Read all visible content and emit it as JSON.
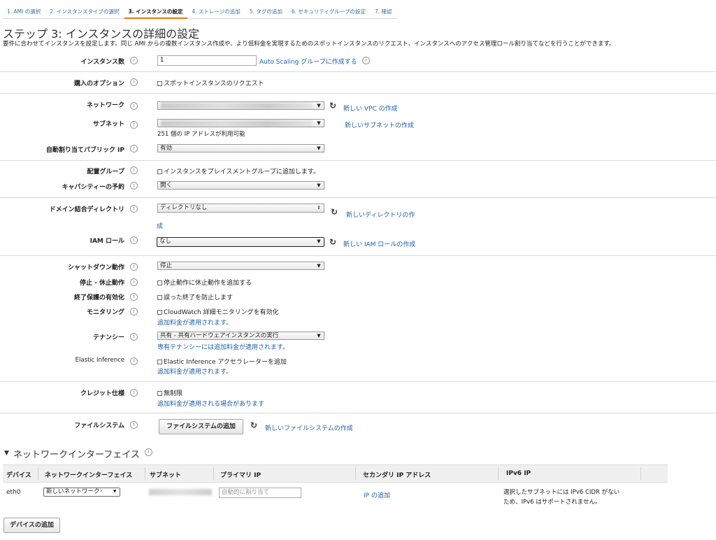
{
  "tabs": [
    {
      "label": "1. AMI の選択"
    },
    {
      "label": "2. インスタンスタイプの選択"
    },
    {
      "label": "3. インスタンスの設定"
    },
    {
      "label": "4. ストレージの追加"
    },
    {
      "label": "5. タグの追加"
    },
    {
      "label": "6. セキュリティグループの設定"
    },
    {
      "label": "7. 確認"
    }
  ],
  "page": {
    "title": "ステップ 3: インスタンスの詳細の設定",
    "description": "要件に合わせてインスタンスを設定します。同じ AMI からの複数インスタンス作成や、より低料金を実現するためのスポットインスタンスのリクエスト、インスタンスへのアクセス管理ロール割り当てなどを行うことができます。"
  },
  "form": {
    "instance_count": {
      "label": "インスタンス数",
      "value": "1",
      "link": "Auto Scaling グループに作成する"
    },
    "purchase": {
      "label": "購入のオプション",
      "checkbox": "スポットインスタンスのリクエスト"
    },
    "network": {
      "label": "ネットワーク",
      "link": "新しい VPC の作成"
    },
    "subnet": {
      "label": "サブネット",
      "link": "新しいサブネットの作成",
      "note": "251 個の IP アドレスが利用可能"
    },
    "public_ip": {
      "label": "自動割り当てパブリック IP",
      "value": "有効"
    },
    "placement": {
      "label": "配置グループ",
      "checkbox": "インスタンスをプレイスメントグループに追加します。"
    },
    "capacity": {
      "label": "キャパシティーの予約",
      "value": "開く"
    },
    "domain": {
      "label": "ドメイン結合ディレクトリ",
      "value": "ディレクトリなし",
      "link_part1": "新しいディレクトリの作",
      "link_part2": "成"
    },
    "iam": {
      "label": "IAM ロール",
      "value": "なし",
      "link": "新しい IAM ロールの作成"
    },
    "shutdown": {
      "label": "シャットダウン動作",
      "value": "停止"
    },
    "stop_hibernate": {
      "label": "停止 - 休止動作",
      "checkbox": "停止動作に休止動作を追加する"
    },
    "termination": {
      "label": "終了保護の有効化",
      "checkbox": "誤った終了を防止します"
    },
    "monitoring": {
      "label": "モニタリング",
      "checkbox": "CloudWatch 詳細モニタリングを有効化",
      "note": "追加料金が適用されます。"
    },
    "tenancy": {
      "label": "テナンシー",
      "value": "共有 - 共有ハードウェアインスタンスの実行",
      "note": "専有テナンシーには追加料金が適用されます。"
    },
    "elastic": {
      "label": "Elastic Inference",
      "checkbox": "Elastic Inference アクセラレーターを追加",
      "note": "追加料金が適用されます。"
    },
    "credit": {
      "label": "クレジット仕様",
      "checkbox": "無制限",
      "note": "追加料金が適用される場合があります"
    },
    "filesystem": {
      "label": "ファイルシステム",
      "button": "ファイルシステムの追加",
      "link": "新しいファイルシステムの作成"
    }
  },
  "network_interfaces": {
    "title": "ネットワークインターフェイス",
    "columns": [
      "デバイス",
      "ネットワークインターフェイス",
      "サブネット",
      "プライマリ IP",
      "セカンダリ IP アドレス",
      "IPv6 IP"
    ],
    "row": {
      "device": "eth0",
      "interface": "新しいネットワーク･",
      "primary_ip_placeholder": "自動的に割り当て",
      "secondary_link": "IP の追加",
      "ipv6_line1": "選択したサブネットには IPv6 CIDR がない",
      "ipv6_line2": "ため、IPv6 はサポートされません。"
    },
    "add_button": "デバイスの追加"
  },
  "icons": {
    "info": "info-icon",
    "refresh": "refresh-icon",
    "dropdown": "chevron-down-icon"
  },
  "colors": {
    "link": "#1f5fa8",
    "active_tab": "#e47911"
  }
}
